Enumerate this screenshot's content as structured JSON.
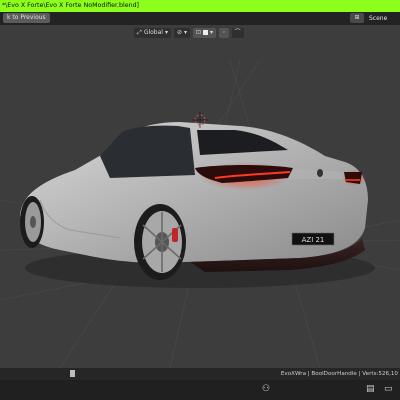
{
  "window": {
    "title": "*\\Evo X Forte\\Evo X Forte NoModifier.blend]"
  },
  "topbar": {
    "back_label": "k to Previous",
    "scene_label": "Scene",
    "scene_icon": "scene-icon"
  },
  "viewport_header": {
    "orientation_label": "Global",
    "orientation_dropdown": "▾",
    "link_icon": "link-icon",
    "snap_icon": "snap-icon"
  },
  "car": {
    "plate_text": "AZI 21"
  },
  "statusbar": {
    "info": "EvoXWra | BoolDoorHandle | Verts:526,10"
  },
  "taskbar": {
    "icons": [
      "people-icon",
      "keyboard-icon",
      "display-icon"
    ]
  }
}
